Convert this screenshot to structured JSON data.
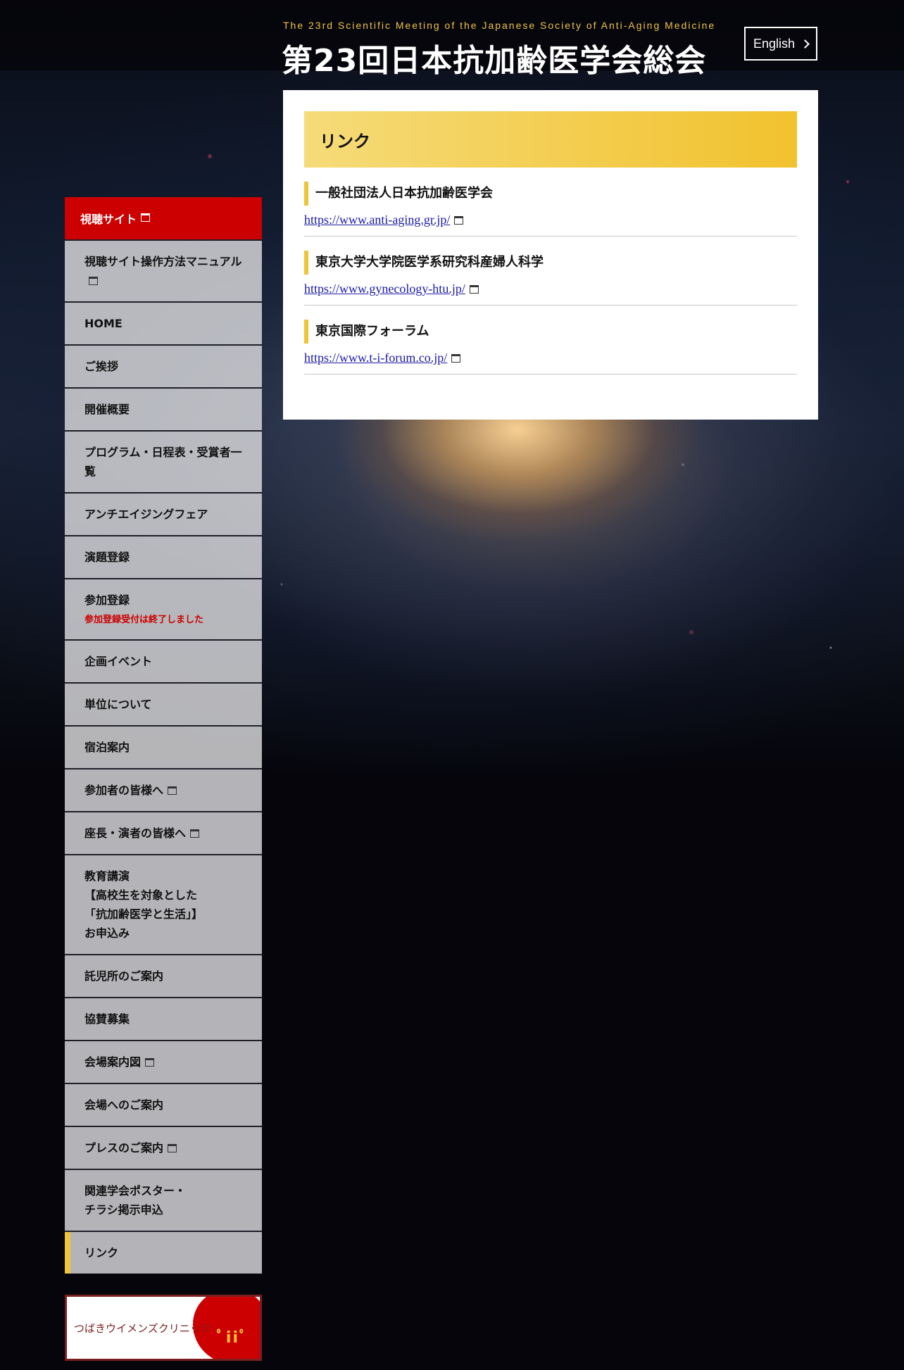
{
  "header": {
    "subtitle": "The 23rd Scientific Meeting of the Japanese Society of Anti-Aging Medicine",
    "title": "第23回日本抗加齢医学会総会",
    "language_button": "English"
  },
  "sidebar": {
    "head_label": "視聴サイト",
    "items": [
      {
        "label": "視聴サイト操作方法マニュアル",
        "external": true
      },
      {
        "label": "HOME"
      },
      {
        "label": "ご挨拶"
      },
      {
        "label": "開催概要"
      },
      {
        "label": "プログラム・日程表・受賞者一覧"
      },
      {
        "label": "アンチエイジングフェア"
      },
      {
        "label": "演題登録"
      },
      {
        "label": "参加登録",
        "note": "参加登録受付は終了しました"
      },
      {
        "label": "企画イベント"
      },
      {
        "label": "単位について"
      },
      {
        "label": "宿泊案内"
      },
      {
        "label": "参加者の皆様へ",
        "external": true
      },
      {
        "label": "座長・演者の皆様へ",
        "external": true
      },
      {
        "label": "教育講演\n【高校生を対象とした\n「抗加齢医学と生活」】\nお申込み"
      },
      {
        "label": "託児所のご案内"
      },
      {
        "label": "協賛募集"
      },
      {
        "label": "会場案内図",
        "external": true
      },
      {
        "label": "会場へのご案内"
      },
      {
        "label": "プレスのご案内",
        "external": true
      },
      {
        "label": "関連学会ポスター・\nチラシ掲示申込"
      },
      {
        "label": "リンク",
        "active": true
      }
    ],
    "banner_text": "つばきウイメンズクリニック"
  },
  "main": {
    "heading": "リンク",
    "links": [
      {
        "title": "一般社団法人日本抗加齢医学会",
        "url": "https://www.anti-aging.gr.jp/"
      },
      {
        "title": "東京大学大学院医学系研究科産婦人科学",
        "url": "https://www.gynecology-htu.jp/"
      },
      {
        "title": "東京国際フォーラム",
        "url": "https://www.t-i-forum.co.jp/"
      }
    ]
  },
  "colors": {
    "accent_red": "#cc0000",
    "accent_gold": "#f0c43a",
    "link_blue": "#1a1aa6"
  }
}
